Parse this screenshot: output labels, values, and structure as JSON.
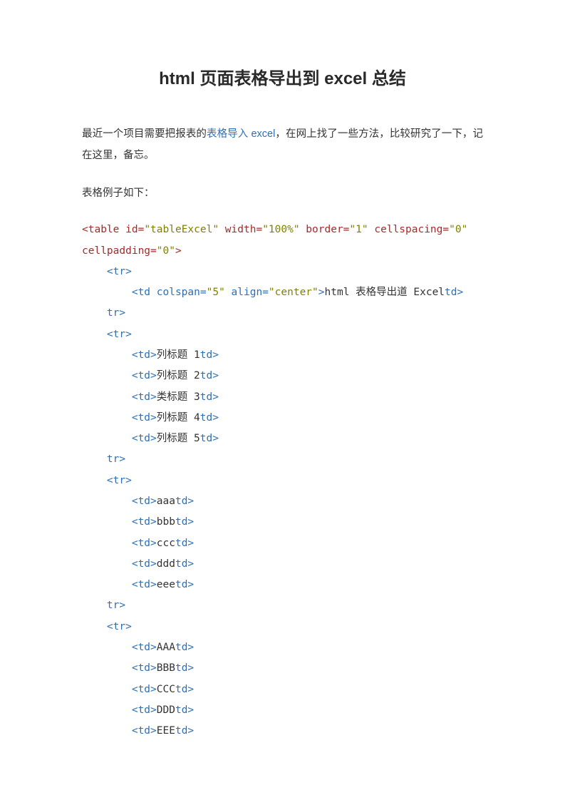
{
  "title": "html 页面表格导出到 excel 总结",
  "intro_prefix": "最近一个项目需要把报表的",
  "intro_link": "表格导入 excel",
  "intro_suffix": "，在网上找了一些方法，比较研究了一下，记在这里，备忘。",
  "example_label": "表格例子如下：",
  "code": {
    "line1a": "<table id=",
    "line1b": "\"tableExcel\"",
    "line1c": " width=",
    "line1d": "\"100%\"",
    "line1e": " border=",
    "line1f": "\"1\"",
    "line1g": " cellspacing=",
    "line1h": "\"0\"",
    "line2a": "cellpadding=",
    "line2b": "\"0\"",
    "line2c": ">",
    "tr_open": "<tr>",
    "tr_close": "tr>",
    "td_open": "<td>",
    "td_close": "td>",
    "row1_td_a": "<td colspan=",
    "row1_td_b": "\"5\"",
    "row1_td_c": " align=",
    "row1_td_d": "\"center\"",
    "row1_td_e": ">",
    "row1_text": "html 表格导出道 Excel",
    "header1": "列标题 1",
    "header2": "列标题 2",
    "header3": "类标题 3",
    "header4": "列标题 4",
    "header5": "列标题 5",
    "r1c1": "aaa",
    "r1c2": "bbb",
    "r1c3": "ccc",
    "r1c4": "ddd",
    "r1c5": "eee",
    "r2c1": "AAA",
    "r2c2": "BBB",
    "r2c3": "CCC",
    "r2c4": "DDD",
    "r2c5": "EEE"
  }
}
